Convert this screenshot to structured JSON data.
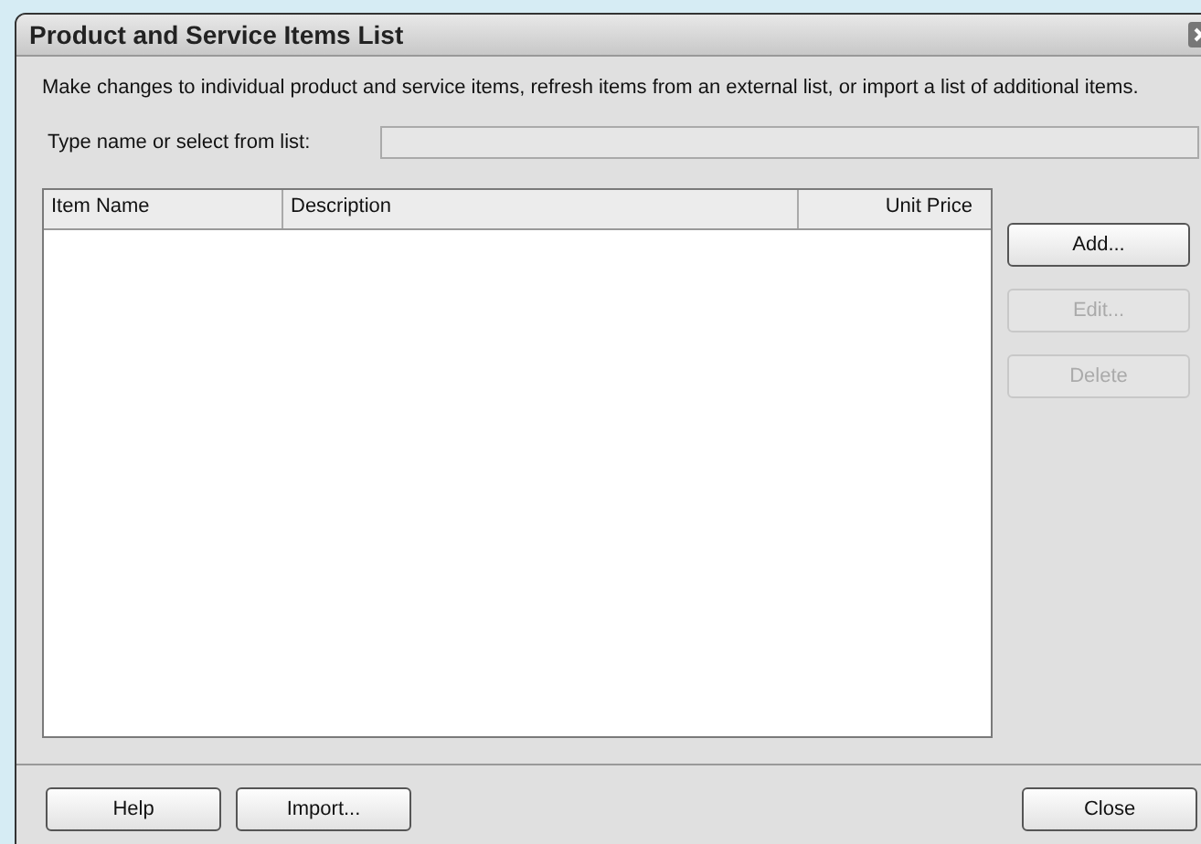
{
  "window": {
    "title": "Product and Service Items List"
  },
  "description": "Make changes to individual product and service items, refresh items from an external list, or import a list of additional items.",
  "name_field": {
    "label": "Type name or select from list:"
  },
  "table": {
    "columns": [
      {
        "label": "Item Name"
      },
      {
        "label": "Description"
      },
      {
        "label": "Unit Price"
      }
    ]
  },
  "side_buttons": [
    {
      "label": "Add...",
      "disabled": false
    },
    {
      "label": "Edit...",
      "disabled": true
    },
    {
      "label": "Delete",
      "disabled": true
    }
  ],
  "footer_buttons_left": [
    {
      "label": "Help",
      "disabled": false
    },
    {
      "label": "Import...",
      "disabled": false
    }
  ],
  "footer_buttons_right": [
    {
      "label": "Close",
      "disabled": false
    }
  ]
}
